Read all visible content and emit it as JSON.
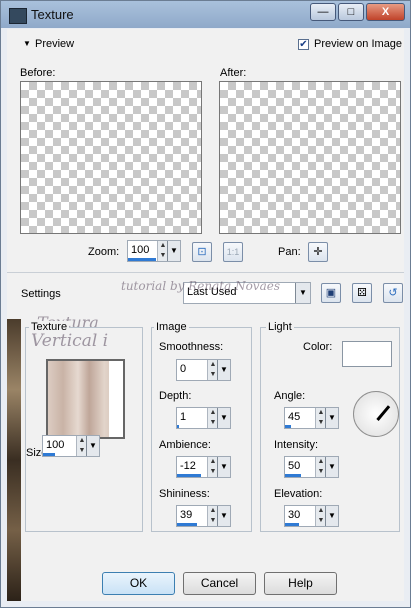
{
  "window": {
    "title": "Texture",
    "minimize": "—",
    "maximize": "□",
    "close": "X"
  },
  "preview": {
    "header": "Preview",
    "preview_on_image_label": "Preview on Image",
    "preview_on_image_checked": true,
    "before_label": "Before:",
    "after_label": "After:",
    "zoom_label": "Zoom:",
    "zoom_value": "100",
    "pan_label": "Pan:"
  },
  "settings": {
    "label": "Settings",
    "preset_value": "Last Used"
  },
  "watermark": {
    "line1": "tutorial by Renata Novaes",
    "line2": "Textura",
    "line3": "Vertical i"
  },
  "texture": {
    "group_title": "Texture",
    "size_label": "Size %:",
    "size_value": "100"
  },
  "image": {
    "group_title": "Image",
    "smoothness_label": "Smoothness:",
    "smoothness_value": "0",
    "depth_label": "Depth:",
    "depth_value": "1",
    "ambience_label": "Ambience:",
    "ambience_value": "-12",
    "shininess_label": "Shininess:",
    "shininess_value": "39"
  },
  "light": {
    "group_title": "Light",
    "color_label": "Color:",
    "color_value": "#ffffff",
    "angle_label": "Angle:",
    "angle_value": "45",
    "intensity_label": "Intensity:",
    "intensity_value": "50",
    "elevation_label": "Elevation:",
    "elevation_value": "30"
  },
  "buttons": {
    "ok": "OK",
    "cancel": "Cancel",
    "help": "Help"
  }
}
